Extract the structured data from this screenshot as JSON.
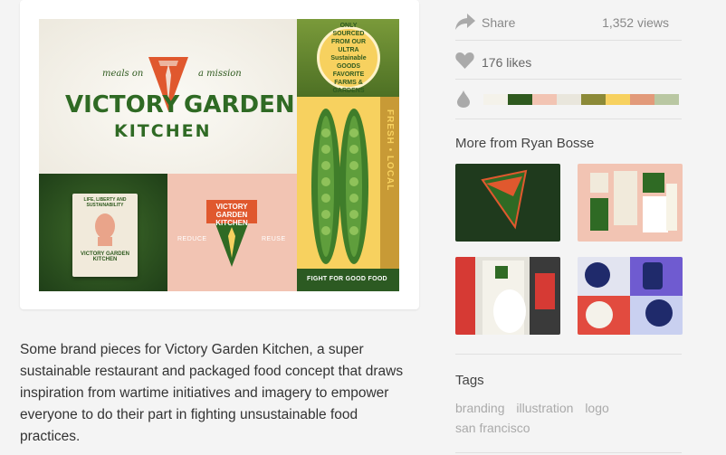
{
  "shot": {
    "logo": {
      "tagline_left": "meals on",
      "tagline_right": "a mission",
      "word_victory": "VICTORY",
      "word_garden": "GARDEN",
      "word_kitchen": "KITCHEN"
    },
    "badge_text": "ONLY SOURCED FROM OUR ULTRA Sustainable GOODS FAVORITE FARMS & GARDENS",
    "vertical_text": "FRESH • LOCAL",
    "fight_text": "FIGHT FOR GOOD FOOD",
    "book_text": "LIFE, LIBERTY AND SUSTAINABILITY",
    "book_brand": "VICTORY GARDEN KITCHEN",
    "pink_brand": "VICTORY GARDEN KITCHEN",
    "pink_left": "REDUCE",
    "pink_right": "REUSE"
  },
  "stats": {
    "share_label": "Share",
    "views": "1,352 views",
    "likes": "176 likes"
  },
  "palette": [
    "#f4f2ea",
    "#2f5a1f",
    "#f2c4b3",
    "#e9e6dc",
    "#8c8a38",
    "#f7d15f",
    "#e29a7a",
    "#b9c7a2"
  ],
  "more": {
    "title": "More from Ryan Bosse",
    "thumbs": [
      {
        "bg": "#1f3a1d"
      },
      {
        "bg": "#f2c4b3"
      },
      {
        "bg": "#d63a34"
      },
      {
        "bg": "#5a74c9"
      }
    ]
  },
  "description": "Some brand pieces for Victory Garden Kitchen, a super sustainable restaurant and packaged food concept that draws inspiration from wartime initiatives and imagery to empower everyone to do their part in fighting unsustainable food practices.",
  "tags": {
    "title": "Tags",
    "items": [
      "branding",
      "illustration",
      "logo",
      "san francisco"
    ]
  }
}
